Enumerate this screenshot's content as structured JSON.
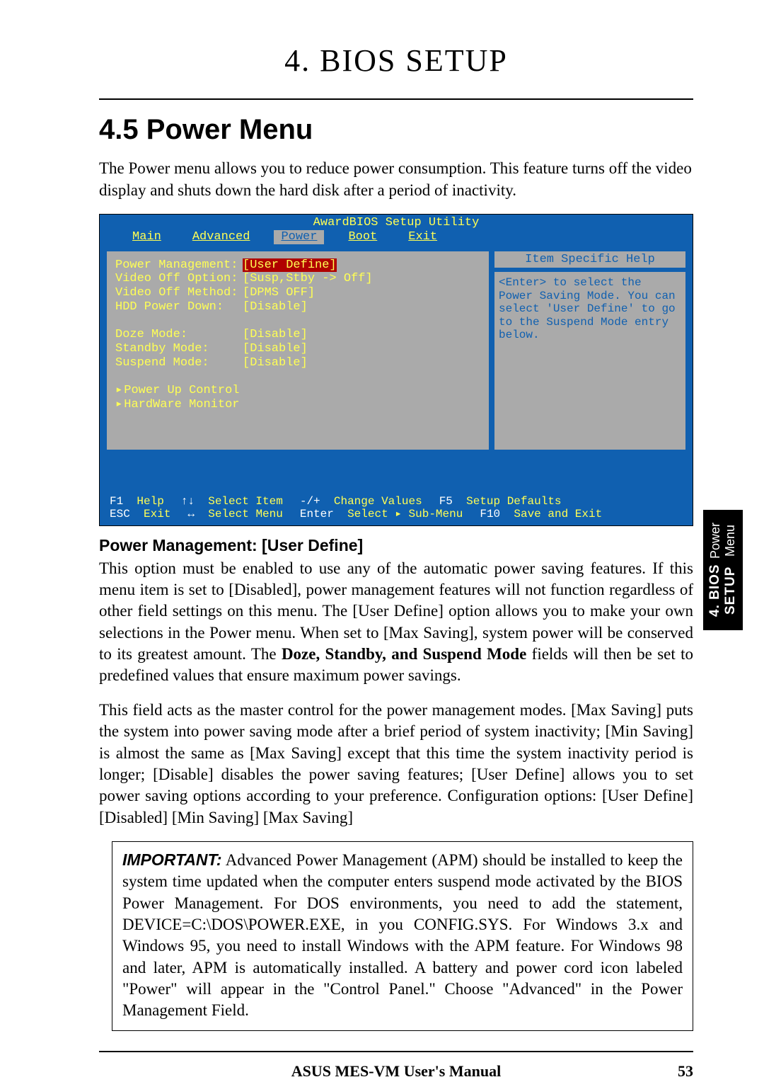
{
  "chapter_title": "4.  BIOS SETUP",
  "section_title": "4.5 Power Menu",
  "intro": "The Power menu allows you to reduce power consumption.  This feature turns off the video display and shuts down the hard disk after a period of inactivity.",
  "bios": {
    "utility_title": "AwardBIOS Setup Utility",
    "tabs": [
      "Main",
      "Advanced",
      "Power",
      "Boot",
      "Exit"
    ],
    "active_tab": "Power",
    "settings": [
      {
        "label": "Power Management:",
        "value": "[User Define]",
        "selected": true
      },
      {
        "label": "Video Off Option:",
        "value": "[Susp,Stby -> Off]",
        "selected": false
      },
      {
        "label": "Video Off Method:",
        "value": "[DPMS OFF]",
        "selected": false
      },
      {
        "label": "HDD Power Down:",
        "value": "[Disable]",
        "selected": false
      },
      {
        "label": "",
        "value": "",
        "selected": false
      },
      {
        "label": "Doze Mode:",
        "value": "[Disable]",
        "selected": false
      },
      {
        "label": "Standby Mode:",
        "value": "[Disable]",
        "selected": false
      },
      {
        "label": "Suspend Mode:",
        "value": "[Disable]",
        "selected": false
      }
    ],
    "submenus": [
      "Power Up Control",
      "HardWare Monitor"
    ],
    "help_title": "Item Specific Help",
    "help_body": "<Enter> to select the Power Saving Mode. You can select 'User Define' to go to the Suspend Mode entry below.",
    "keys": [
      {
        "k": "F1",
        "l": "Help"
      },
      {
        "k": "↑↓",
        "l": "Select Item"
      },
      {
        "k": "-/+",
        "l": "Change Values"
      },
      {
        "k": "F5",
        "l": "Setup Defaults"
      },
      {
        "k": "ESC",
        "l": "Exit"
      },
      {
        "k": "↔",
        "l": "Select Menu"
      },
      {
        "k": "Enter",
        "l": "Select ▸ Sub-Menu"
      },
      {
        "k": "F10",
        "l": "Save and Exit"
      }
    ]
  },
  "subsection_title": "Power Management: [User Define]",
  "para1_a": "This option must be enabled to use any of the automatic power saving features. If this menu item is set to [Disabled], power management features will not function regardless of other field settings on this menu. The [User Define] option allows you to make your own selections in the Power menu. When set to [Max Saving], system power will be conserved to its greatest amount. The ",
  "para1_bold": "Doze, Standby, and Suspend Mode",
  "para1_b": " fields will then be set to predefined values that ensure maximum power savings.",
  "para2": "This field acts as the master control for the power management modes. [Max Saving] puts the system into power saving mode after a brief period of system inactivity; [Min Saving] is almost the same as [Max Saving] except that this time the system inactivity period is longer; [Disable] disables the power saving features; [User Define] allows you to set power saving options according to your preference. Configuration options: [User Define] [Disabled] [Min Saving] [Max Saving]",
  "important_lead": "IMPORTANT:",
  "important_body": " Advanced Power Management (APM) should be installed to keep the system time updated when the computer enters suspend mode activated by the BIOS Power Management. For DOS environments, you need to add the statement, DEVICE=C:\\DOS\\POWER.EXE, in you CONFIG.SYS. For Windows 3.x and Windows 95, you need to install Windows with the APM feature. For Windows 98 and later, APM is automatically installed. A battery and power cord icon labeled \"Power\" will appear in the \"Control Panel.\"  Choose \"Advanced\" in the Power Management Field.",
  "footer_center": "ASUS MES-VM User's Manual",
  "page_number": "53",
  "side_tab_line1": "4. BIOS SETUP",
  "side_tab_line2": "Power Menu"
}
